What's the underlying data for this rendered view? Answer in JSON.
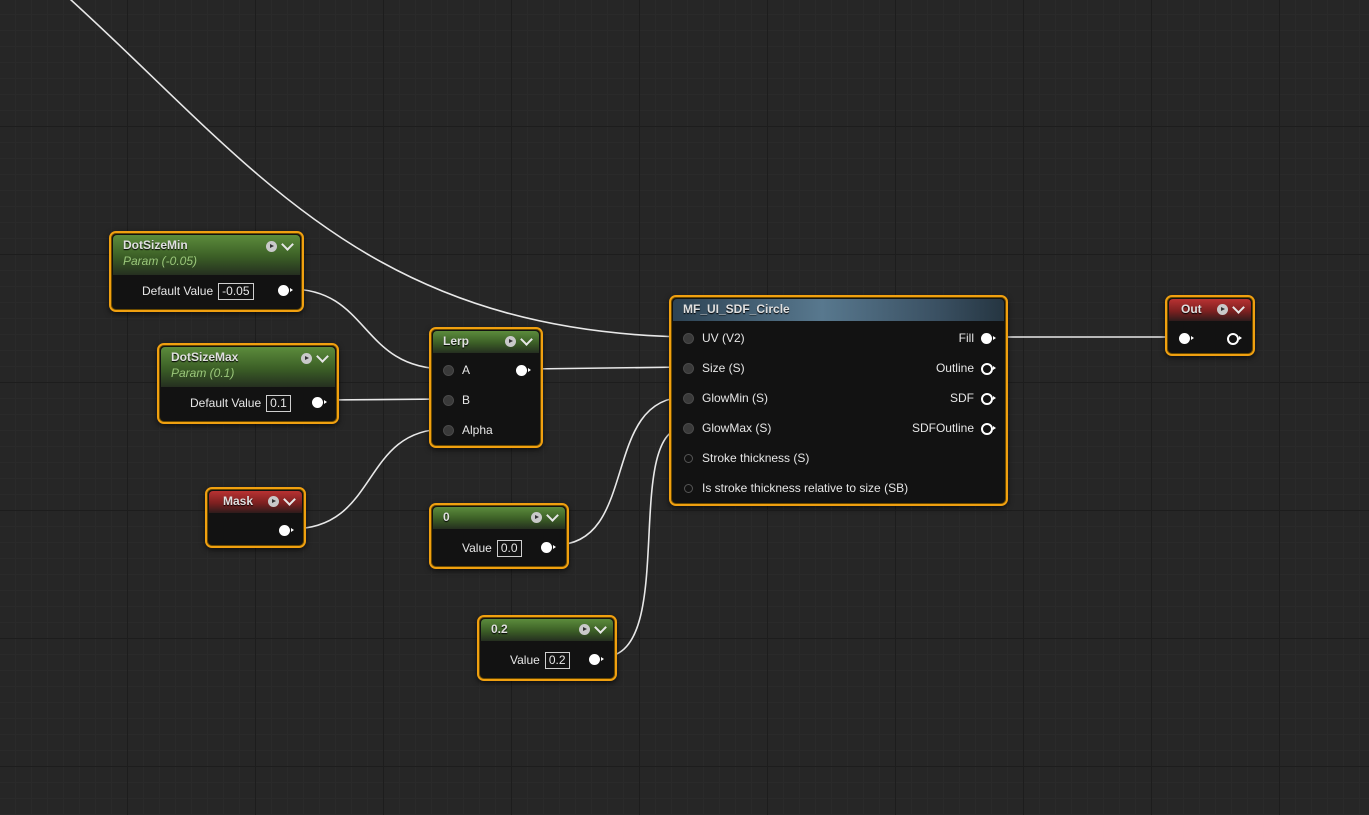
{
  "nodes": {
    "dot_size_min": {
      "title": "DotSizeMin",
      "subtitle": "Param (-0.05)",
      "field_label": "Default Value",
      "field_value": "-0.05"
    },
    "dot_size_max": {
      "title": "DotSizeMax",
      "subtitle": "Param (0.1)",
      "field_label": "Default Value",
      "field_value": "0.1"
    },
    "mask": {
      "title": "Mask"
    },
    "lerp": {
      "title": "Lerp",
      "inputs": [
        "A",
        "B",
        "Alpha"
      ]
    },
    "const_zero": {
      "title": "0",
      "field_label": "Value",
      "field_value": "0.0"
    },
    "const_point2": {
      "title": "0.2",
      "field_label": "Value",
      "field_value": "0.2"
    },
    "sdf_circle": {
      "title": "MF_UI_SDF_Circle",
      "inputs": [
        "UV (V2)",
        "Size (S)",
        "GlowMin (S)",
        "GlowMax (S)",
        "Stroke thickness (S)",
        "Is stroke thickness relative to size (SB)"
      ],
      "outputs": [
        "Fill",
        "Outline",
        "SDF",
        "SDFOutline"
      ]
    },
    "out": {
      "title": "Out"
    }
  },
  "colors": {
    "selection_border": "#f0a010",
    "param_header": "#4a7a30",
    "function_header": "#58788e",
    "output_header": "#9a2828",
    "wire": "#e8e8e8"
  }
}
